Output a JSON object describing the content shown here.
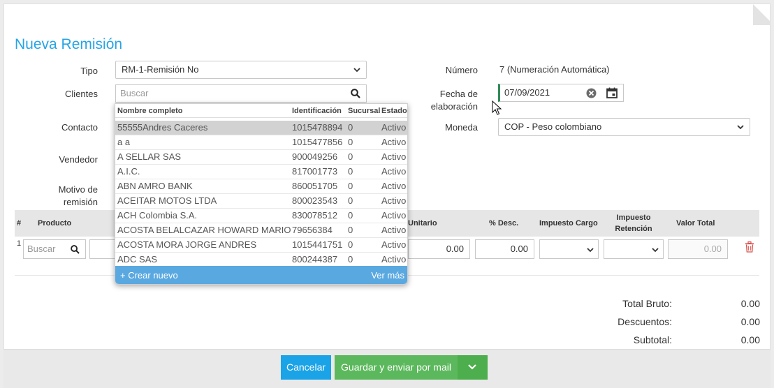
{
  "page_title": "Nueva Remisión",
  "form": {
    "tipo_label": "Tipo",
    "tipo_value": "RM-1-Remisión No",
    "clientes_label": "Clientes",
    "clientes_placeholder": "Buscar",
    "contacto_label": "Contacto",
    "vendedor_label": "Vendedor",
    "motivo_label_1": "Motivo de",
    "motivo_label_2": "remisión",
    "numero_label": "Número",
    "numero_value": "7 (Numeración Automática)",
    "fecha_label_1": "Fecha de",
    "fecha_label_2": "elaboración",
    "fecha_value": "07/09/2021",
    "moneda_label": "Moneda",
    "moneda_value": "COP - Peso colombiano"
  },
  "clients_dropdown": {
    "columns": [
      "Nombre completo",
      "Identificación",
      "Sucursal",
      "Estado"
    ],
    "rows": [
      {
        "name": "55555Andres Caceres",
        "id": "1015478894",
        "branch": "0",
        "status": "Activo"
      },
      {
        "name": "a a",
        "id": "1015477856",
        "branch": "0",
        "status": "Activo"
      },
      {
        "name": "A SELLAR SAS",
        "id": "900049256",
        "branch": "0",
        "status": "Activo"
      },
      {
        "name": "A.I.C.",
        "id": "817001773",
        "branch": "0",
        "status": "Activo"
      },
      {
        "name": "ABN AMRO BANK",
        "id": "860051705",
        "branch": "0",
        "status": "Activo"
      },
      {
        "name": "ACEITAR MOTOS LTDA",
        "id": "800023543",
        "branch": "0",
        "status": "Activo"
      },
      {
        "name": "ACH Colombia S.A.",
        "id": "830078512",
        "branch": "0",
        "status": "Activo"
      },
      {
        "name": "ACOSTA BELALCAZAR HOWARD MARIO",
        "id": "79656384",
        "branch": "0",
        "status": "Activo"
      },
      {
        "name": "ACOSTA MORA JORGE ANDRES",
        "id": "1015441751",
        "branch": "0",
        "status": "Activo"
      },
      {
        "name": "ADC SAS",
        "id": "800244387",
        "branch": "0",
        "status": "Activo"
      }
    ],
    "create_new": "+ Crear nuevo",
    "see_more": "Ver más"
  },
  "items_table": {
    "headers": {
      "num": "#",
      "product": "Producto",
      "unit": "Unitario",
      "discount": "% Desc.",
      "tax_charge": "Impuesto Cargo",
      "tax_ret_1": "Impuesto",
      "tax_ret_2": "Retención",
      "total": "Valor Total"
    },
    "row": {
      "num": "1",
      "search_placeholder": "Buscar",
      "unit_price": "0.00",
      "discount": "0.00",
      "total": "0.00"
    }
  },
  "totals": {
    "gross_label": "Total Bruto:",
    "gross_value": "0.00",
    "discounts_label": "Descuentos:",
    "discounts_value": "0.00",
    "subtotal_label": "Subtotal:",
    "subtotal_value": "0.00"
  },
  "footer": {
    "cancel": "Cancelar",
    "save_send": "Guardar y enviar por mail"
  },
  "icons": {
    "search": "search-icon",
    "chevron": "chevron-down-icon",
    "clear": "clear-icon",
    "calendar": "calendar-icon",
    "trash": "trash-icon",
    "cursor": "mouse-cursor-icon"
  },
  "colors": {
    "title": "#27a4e4",
    "cancel_button": "#1aa3e6",
    "save_button": "#5cb85c",
    "dropdown_footer": "#5aa8e0",
    "date_accent": "#2e8b57",
    "trash": "#d9534f"
  }
}
